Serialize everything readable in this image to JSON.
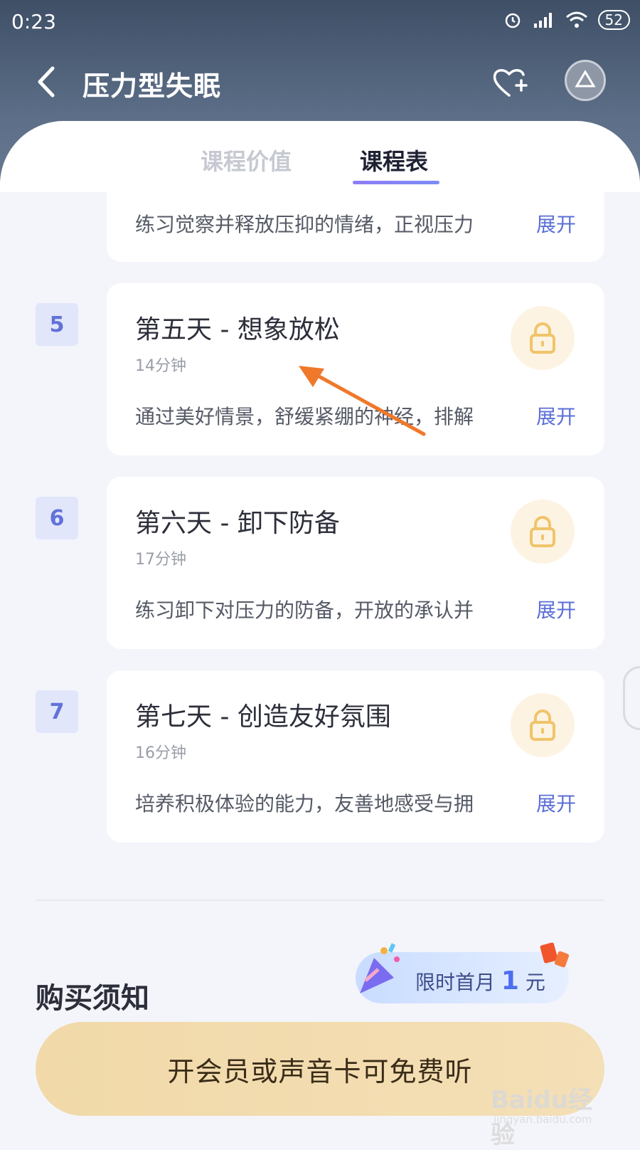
{
  "status_bar": {
    "time": "0:23",
    "battery": "52"
  },
  "header": {
    "title": "压力型失眠"
  },
  "tabs": [
    {
      "label": "课程价值",
      "active": false
    },
    {
      "label": "课程表",
      "active": true
    }
  ],
  "partial_card": {
    "description": "练习觉察并释放压抑的情绪，正视压力",
    "expand_label": "展开"
  },
  "lessons": [
    {
      "day": "5",
      "title": "第五天 - 想象放松",
      "duration": "14分钟",
      "description": "通过美好情景，舒缓紧绷的神经，排解",
      "expand_label": "展开"
    },
    {
      "day": "6",
      "title": "第六天 - 卸下防备",
      "duration": "17分钟",
      "description": "练习卸下对压力的防备，开放的承认并",
      "expand_label": "展开"
    },
    {
      "day": "7",
      "title": "第七天 - 创造友好氛围",
      "duration": "16分钟",
      "description": "培养积极体验的能力，友善地感受与拥",
      "expand_label": "展开"
    }
  ],
  "purchase_notice": {
    "title": "购买须知"
  },
  "promo": {
    "prefix": "限时首月",
    "number": "1",
    "suffix": "元"
  },
  "cta": {
    "label": "开会员或声音卡可免费听"
  },
  "watermark": {
    "text": "Baidu经验",
    "sub": "jingyan.baidu.com"
  },
  "colors": {
    "accent": "#5b6fd6",
    "cta_bg": "#f1d9a9",
    "lock_icon": "#f0c46a"
  }
}
